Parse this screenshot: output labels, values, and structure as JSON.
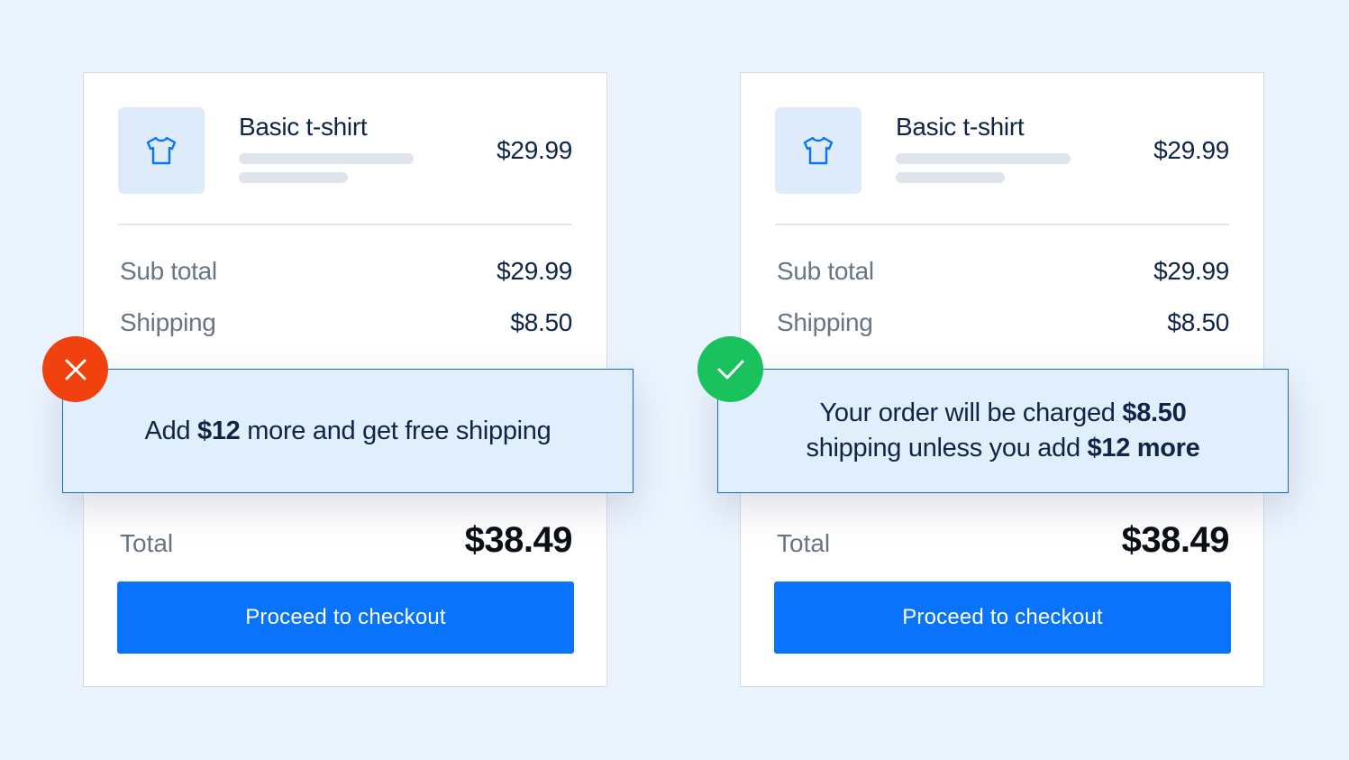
{
  "colors": {
    "background": "#EBF3FE",
    "primary_button": "#0A73FB",
    "bad_badge": "#F0410F",
    "good_badge": "#19C25C",
    "notice_bg": "#E1EEFC"
  },
  "cards": [
    {
      "product": {
        "icon": "t-shirt-icon",
        "name": "Basic t-shirt",
        "price": "$29.99"
      },
      "subtotal": {
        "label": "Sub total",
        "value": "$29.99"
      },
      "shipping": {
        "label": "Shipping",
        "value": "$8.50"
      },
      "notice": {
        "status_icon": "close-icon",
        "parts": [
          "Add ",
          "$12",
          " more and get free shipping"
        ]
      },
      "total": {
        "label": "Total",
        "value": "$38.49"
      },
      "checkout_label": "Proceed to checkout"
    },
    {
      "product": {
        "icon": "t-shirt-icon",
        "name": "Basic t-shirt",
        "price": "$29.99"
      },
      "subtotal": {
        "label": "Sub total",
        "value": "$29.99"
      },
      "shipping": {
        "label": "Shipping",
        "value": "$8.50"
      },
      "notice": {
        "status_icon": "check-icon",
        "line1": [
          "Your order will be charged ",
          "$8.50"
        ],
        "line2": [
          "shipping unless you add ",
          "$12 more"
        ]
      },
      "total": {
        "label": "Total",
        "value": "$38.49"
      },
      "checkout_label": "Proceed to checkout"
    }
  ]
}
